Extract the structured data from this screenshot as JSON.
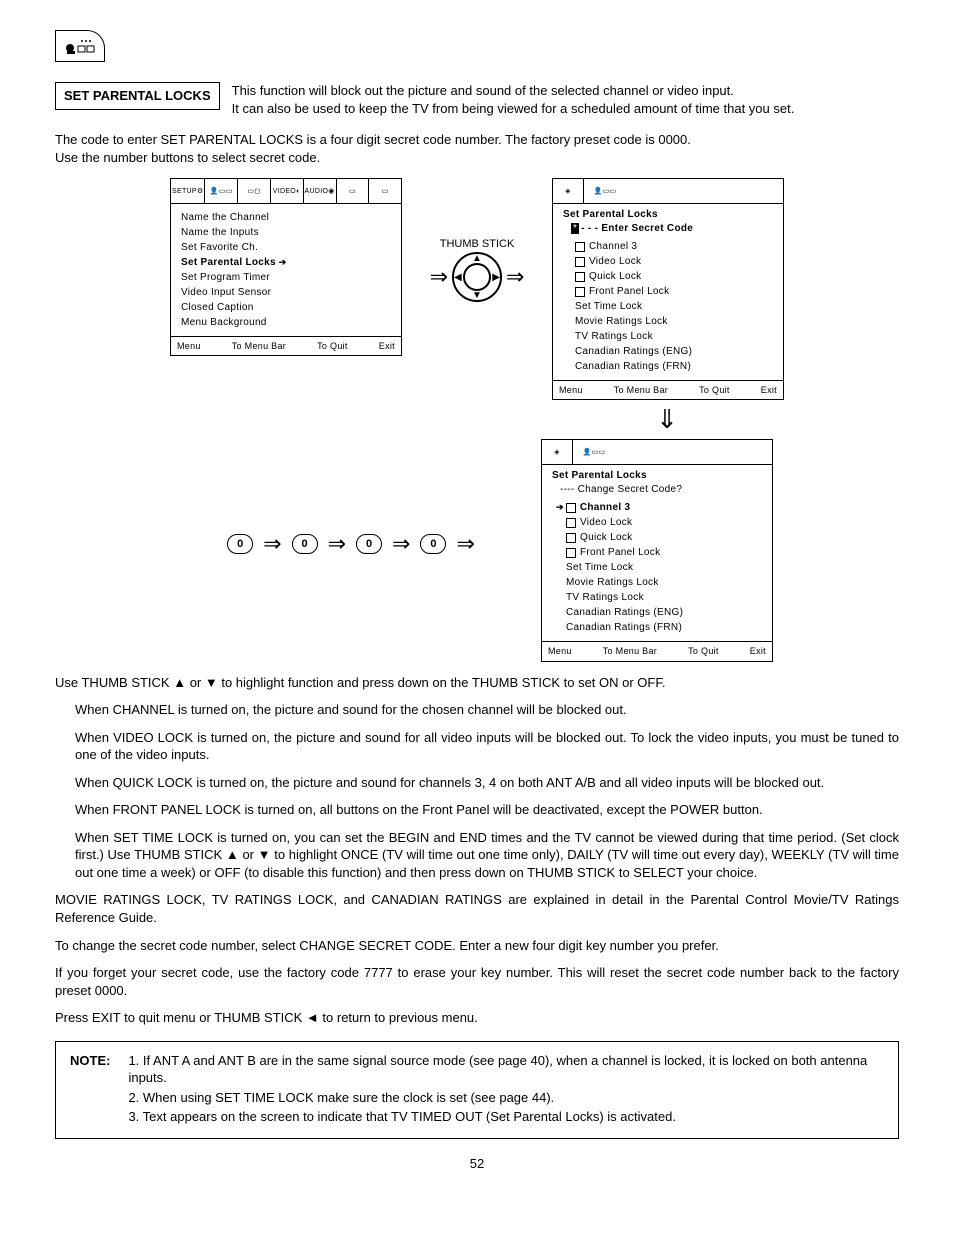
{
  "page_number": "52",
  "section_title": "SET PARENTAL LOCKS",
  "intro_line1": "This function will block out the picture and sound of the selected channel or video input.",
  "intro_line2": "It can also be used to keep the TV from being viewed for a scheduled amount of time that you set.",
  "code_para1": "The code to enter SET PARENTAL LOCKS is a four digit secret code number.  The factory preset code is 0000.",
  "code_para2": "Use the number buttons to select secret code.",
  "thumb_label": "THUMB STICK",
  "zero": "0",
  "osd1": {
    "tabs": [
      "SETUP",
      "",
      "",
      "VIDEO",
      "AUDIO",
      "",
      ""
    ],
    "items": [
      "Name the Channel",
      "Name the Inputs",
      "Set Favorite Ch.",
      "Set Parental Locks",
      "Set Program Timer",
      "Video Input Sensor",
      "Closed Caption",
      "Menu Background"
    ],
    "footer": {
      "a": "Menu",
      "b": "To Menu Bar",
      "c": "To Quit",
      "d": "Exit"
    }
  },
  "osd2": {
    "title": "Set Parental Locks",
    "sub": "- - -   Enter Secret Code",
    "items": [
      "Channel 3",
      "Video Lock",
      "Quick Lock",
      "Front Panel Lock",
      "Set Time Lock",
      "Movie Ratings Lock",
      "TV Ratings Lock",
      "Canadian Ratings (ENG)",
      "Canadian Ratings (FRN)"
    ],
    "checkboxed": [
      0,
      1,
      2,
      3
    ],
    "footer": {
      "a": "Menu",
      "b": "To Menu Bar",
      "c": "To Quit",
      "d": "Exit"
    }
  },
  "osd3": {
    "title": "Set Parental Locks",
    "sub": "----   Change Secret Code?",
    "selected": 0,
    "items": [
      "Channel 3",
      "Video Lock",
      "Quick Lock",
      "Front Panel Lock",
      "Set Time Lock",
      "Movie Ratings Lock",
      "TV Ratings Lock",
      "Canadian Ratings (ENG)",
      "Canadian Ratings (FRN)"
    ],
    "checkboxed": [
      0,
      1,
      2,
      3
    ],
    "footer": {
      "a": "Menu",
      "b": "To Menu Bar",
      "c": "To Quit",
      "d": "Exit"
    }
  },
  "body": {
    "p1": "Use THUMB STICK ▲ or ▼ to highlight function and press down on the THUMB STICK to set ON or OFF.",
    "p2": "When CHANNEL is turned on, the picture and sound for the chosen channel will be blocked out.",
    "p3": "When VIDEO LOCK is turned on, the picture and sound for all video inputs will be blocked out. To lock the video inputs, you must be tuned to one of the video inputs.",
    "p4": "When QUICK LOCK is turned on, the picture and sound for channels 3, 4 on both ANT A/B and all video inputs will be blocked out.",
    "p5": "When FRONT PANEL LOCK is turned on, all buttons on the Front Panel will be deactivated, except the POWER button.",
    "p6": "When SET TIME LOCK is turned on, you can set the BEGIN and END times and the TV cannot be viewed during that time period. (Set clock first.) Use THUMB STICK ▲ or ▼ to highlight ONCE (TV will time out one time only), DAILY (TV will time out every day), WEEKLY (TV will time out one time a week) or OFF (to disable this function) and then press down on THUMB STICK to SELECT your choice.",
    "p7": "MOVIE RATINGS LOCK, TV RATINGS LOCK, and CANADIAN RATINGS are explained in detail in the Parental Control Movie/TV Ratings Reference Guide.",
    "p8": "To change the secret code number, select CHANGE SECRET CODE.  Enter a new four digit key number you prefer.",
    "p9": "If you forget your secret code, use the factory code 7777 to erase your key number. This will reset the secret code number back to the factory preset 0000.",
    "p10": "Press EXIT to quit menu or THUMB STICK ◄ to return to previous menu."
  },
  "note": {
    "label": "NOTE:",
    "n1": "1. If ANT A and ANT B are in the same signal source mode (see page 40), when a channel is locked, it is locked on both antenna inputs.",
    "n2": "2. When using SET TIME LOCK make sure the clock is set (see page 44).",
    "n3": "3. Text appears on the screen to indicate that TV TIMED OUT (Set Parental Locks) is activated."
  }
}
